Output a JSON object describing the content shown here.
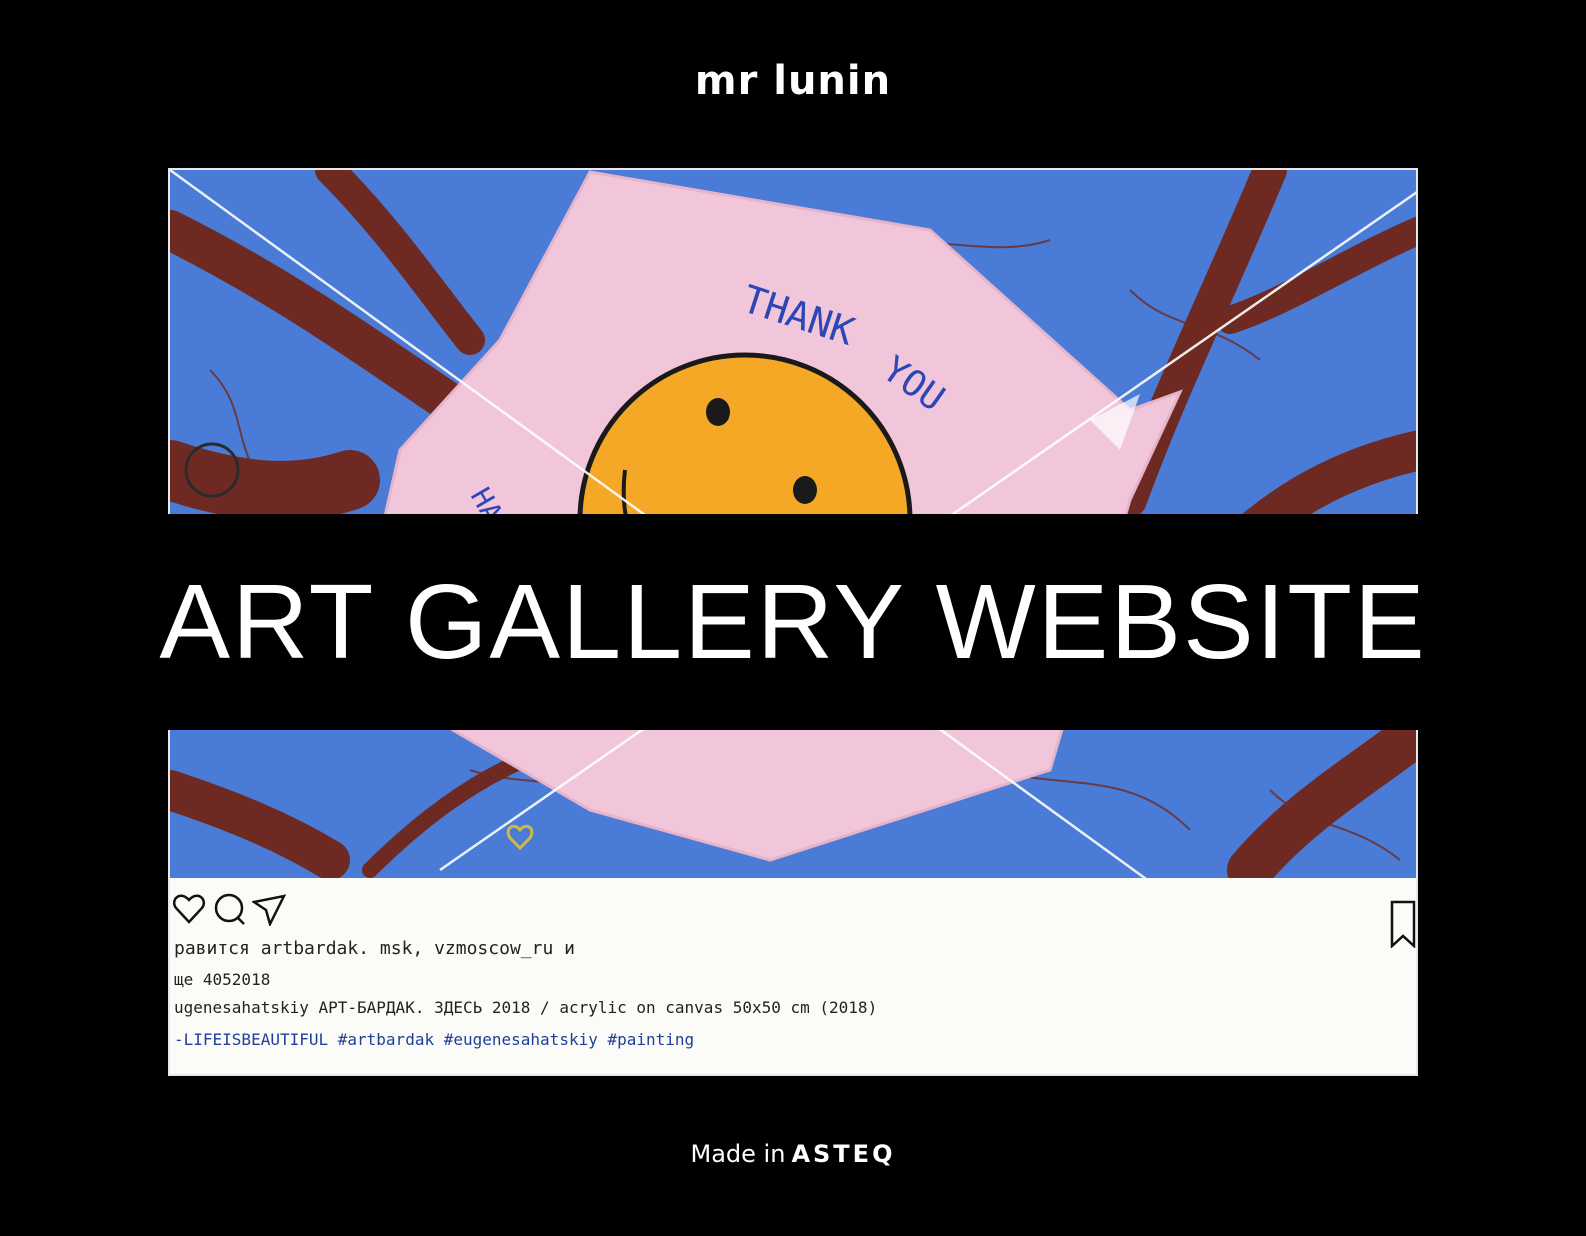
{
  "header": {
    "logo_text": "mr lunin"
  },
  "hero": {
    "title": "ART GALLERY WEBSITE"
  },
  "painting": {
    "sign_text_top": "THANK",
    "sign_text_mid": "YOU",
    "sign_text_left": "HA",
    "caption_lines": [
      "равится  artbardak. msk,  vzmoscow_ru  и",
      "ще  4052018",
      "ugenesahatskiy   АРТ-БАРДАК.  ЗДЕСЬ 2018 / acrylic on canvas   50x50 cm   (2018)",
      "-LIFEISBEAUTIFUL   #artbardak   #eugenesahatskiy   #painting"
    ],
    "colors": {
      "sky": "#4a7bd6",
      "branches": "#6e2a22",
      "sign": "#f2c6da",
      "smiley": "#f5a825",
      "card": "#fbfbf8"
    }
  },
  "footer": {
    "made_in": "Made in",
    "brand": "ASTEQ"
  }
}
